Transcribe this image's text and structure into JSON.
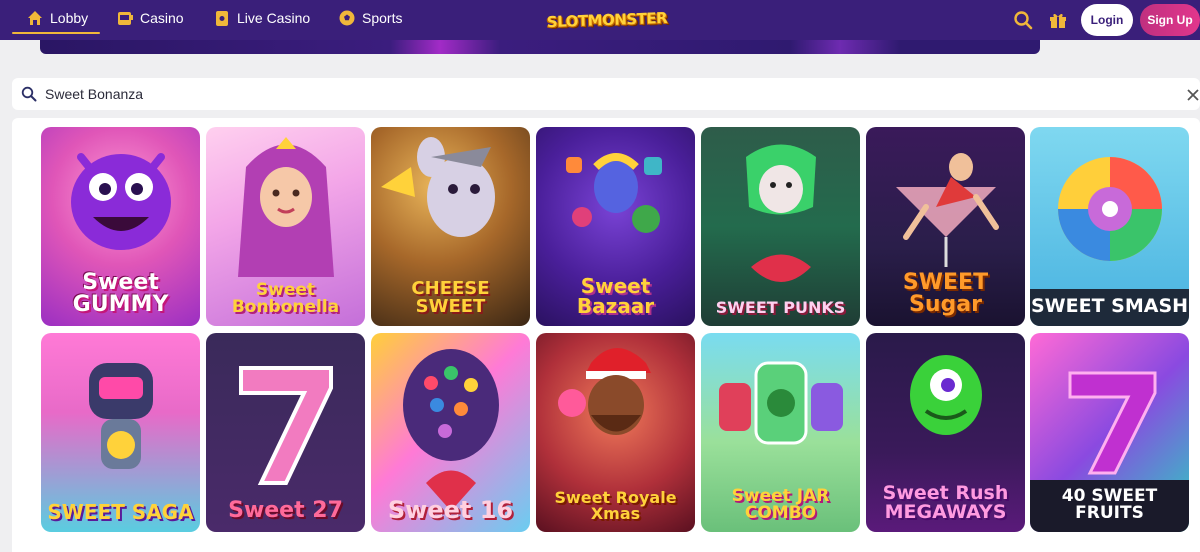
{
  "nav": {
    "items": [
      {
        "label": "Lobby",
        "active": true,
        "icon": "home-icon"
      },
      {
        "label": "Casino",
        "active": false,
        "icon": "slot-machine-icon"
      },
      {
        "label": "Live Casino",
        "active": false,
        "icon": "playing-card-icon"
      },
      {
        "label": "Sports",
        "active": false,
        "icon": "soccer-ball-icon"
      }
    ],
    "logo": "SLOTMONSTER",
    "login_label": "Login",
    "signup_label": "Sign Up",
    "icons": [
      "search-icon",
      "gift-icon"
    ],
    "colors": {
      "bar": "#3a1f7a",
      "accent": "#f0b73a",
      "signup": "#d8338a"
    }
  },
  "search": {
    "value": "Sweet Bonanza",
    "icon": "search-icon",
    "clear_icon": "close-icon"
  },
  "games": [
    {
      "title": "Sweet GUMMY"
    },
    {
      "title": "Sweet Bonbonella"
    },
    {
      "title": "CHEESE SWEET"
    },
    {
      "title": "Sweet Bazaar"
    },
    {
      "title": "SWEET PUNKS"
    },
    {
      "title": "SWEET Sugar"
    },
    {
      "title": "SWEET SMASH"
    },
    {
      "title": "SWEET SAGA"
    },
    {
      "title": "Sweet 27"
    },
    {
      "title": "Sweet 16"
    },
    {
      "title": "Sweet Royale Xmas"
    },
    {
      "title": "Sweet JAR COMBO"
    },
    {
      "title": "Sweet Rush MEGAWAYS"
    },
    {
      "title": "40 SWEET FRUITS"
    }
  ]
}
